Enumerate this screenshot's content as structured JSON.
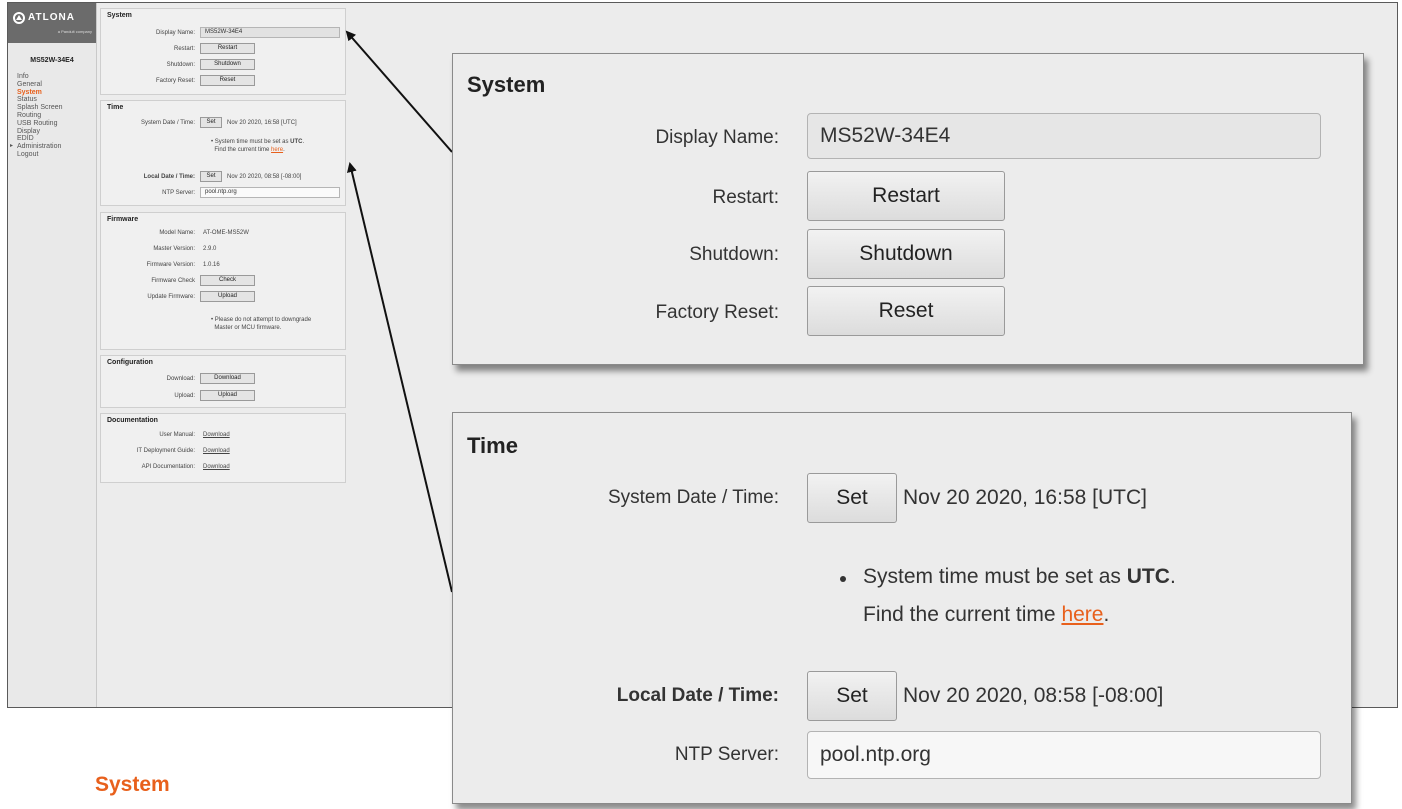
{
  "brand": {
    "logo_text": "ATLONA",
    "logo_sub": "a Panduit company",
    "accent": "#e8601c"
  },
  "sidebar": {
    "device_name": "MS52W-34E4",
    "items": [
      {
        "label": "Info"
      },
      {
        "label": "General"
      },
      {
        "label": "System"
      },
      {
        "label": "Status"
      },
      {
        "label": "Splash Screen"
      },
      {
        "label": "Routing"
      },
      {
        "label": "USB Routing"
      },
      {
        "label": "Display"
      },
      {
        "label": "EDID"
      },
      {
        "label": "Administration"
      },
      {
        "label": "Logout"
      }
    ]
  },
  "system": {
    "title": "System",
    "display_name_label": "Display Name:",
    "display_name_value": "MS52W-34E4",
    "restart_label": "Restart:",
    "restart_button": "Restart",
    "shutdown_label": "Shutdown:",
    "shutdown_button": "Shutdown",
    "factory_reset_label": "Factory Reset:",
    "reset_button": "Reset"
  },
  "time": {
    "title": "Time",
    "system_dt_label": "System Date / Time:",
    "set_button": "Set",
    "system_dt_value": "Nov 20 2020, 16:58 [UTC]",
    "note_line1_prefix": "System time must be set as",
    "note_line1_bold": "UTC",
    "note_line2_prefix": "Find the current time",
    "note_link": "here",
    "local_dt_label": "Local Date / Time:",
    "local_dt_value": "Nov 20 2020, 08:58 [-08:00]",
    "ntp_label": "NTP Server:",
    "ntp_value": "pool.ntp.org"
  },
  "firmware": {
    "title": "Firmware",
    "model_label": "Model Name:",
    "model_value": "AT-OME-MS52W",
    "master_label": "Master Version:",
    "master_value": "2.9.0",
    "fw_label": "Firmware Version:",
    "fw_value": "1.0.16",
    "check_label": "Firmware Check",
    "check_button": "Check",
    "update_label": "Update Firmware:",
    "upload_button": "Upload",
    "note_line1": "Please do not attempt to downgrade",
    "note_line2": "Master or MCU firmware."
  },
  "configuration": {
    "title": "Configuration",
    "download_label": "Download:",
    "download_button": "Download",
    "upload_label": "Upload:",
    "upload_button": "Upload"
  },
  "documentation": {
    "title": "Documentation",
    "user_manual_label": "User Manual:",
    "it_guide_label": "IT Deployment Guide:",
    "api_label": "API Documentation:",
    "link_text": "Download"
  },
  "page_heading": "System"
}
